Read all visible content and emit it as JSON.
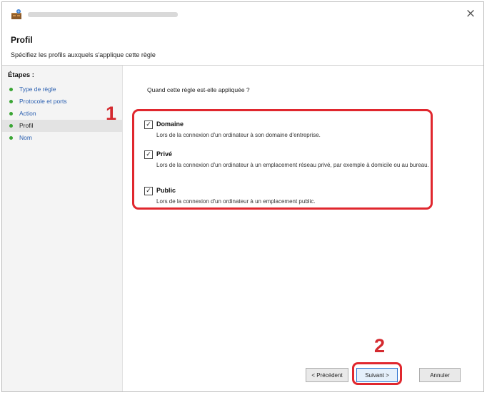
{
  "window": {
    "close_glyph": "×"
  },
  "header": {
    "title": "Profil",
    "description": "Spécifiez les profils auxquels s'applique cette règle"
  },
  "sidebar": {
    "title": "Étapes :",
    "items": [
      {
        "label": "Type de règle"
      },
      {
        "label": "Protocole et ports"
      },
      {
        "label": "Action"
      },
      {
        "label": "Profil"
      },
      {
        "label": "Nom"
      }
    ]
  },
  "main": {
    "question": "Quand cette règle est-elle appliquée ?",
    "profiles": [
      {
        "name": "Domaine",
        "checked": true,
        "description": "Lors de la connexion d'un ordinateur à son domaine d'entreprise."
      },
      {
        "name": "Privé",
        "checked": true,
        "description": "Lors de la connexion d'un ordinateur à un emplacement réseau privé, par exemple à domicile ou au bureau."
      },
      {
        "name": "Public",
        "checked": true,
        "description": "Lors de la connexion d'un ordinateur à un emplacement public."
      }
    ],
    "checkbox_glyph": "✓"
  },
  "buttons": {
    "previous": "< Précédent",
    "next": "Suivant >",
    "cancel": "Annuler"
  },
  "annotations": {
    "step1": "1",
    "step2": "2",
    "color": "#d42a2f"
  },
  "icons": {
    "app": "firewall-icon",
    "close": "close-icon",
    "step_bullet": "green-dot-icon"
  },
  "colors": {
    "link": "#2a5fb0",
    "step_dot": "#3aa534",
    "highlight": "#e0272e"
  }
}
